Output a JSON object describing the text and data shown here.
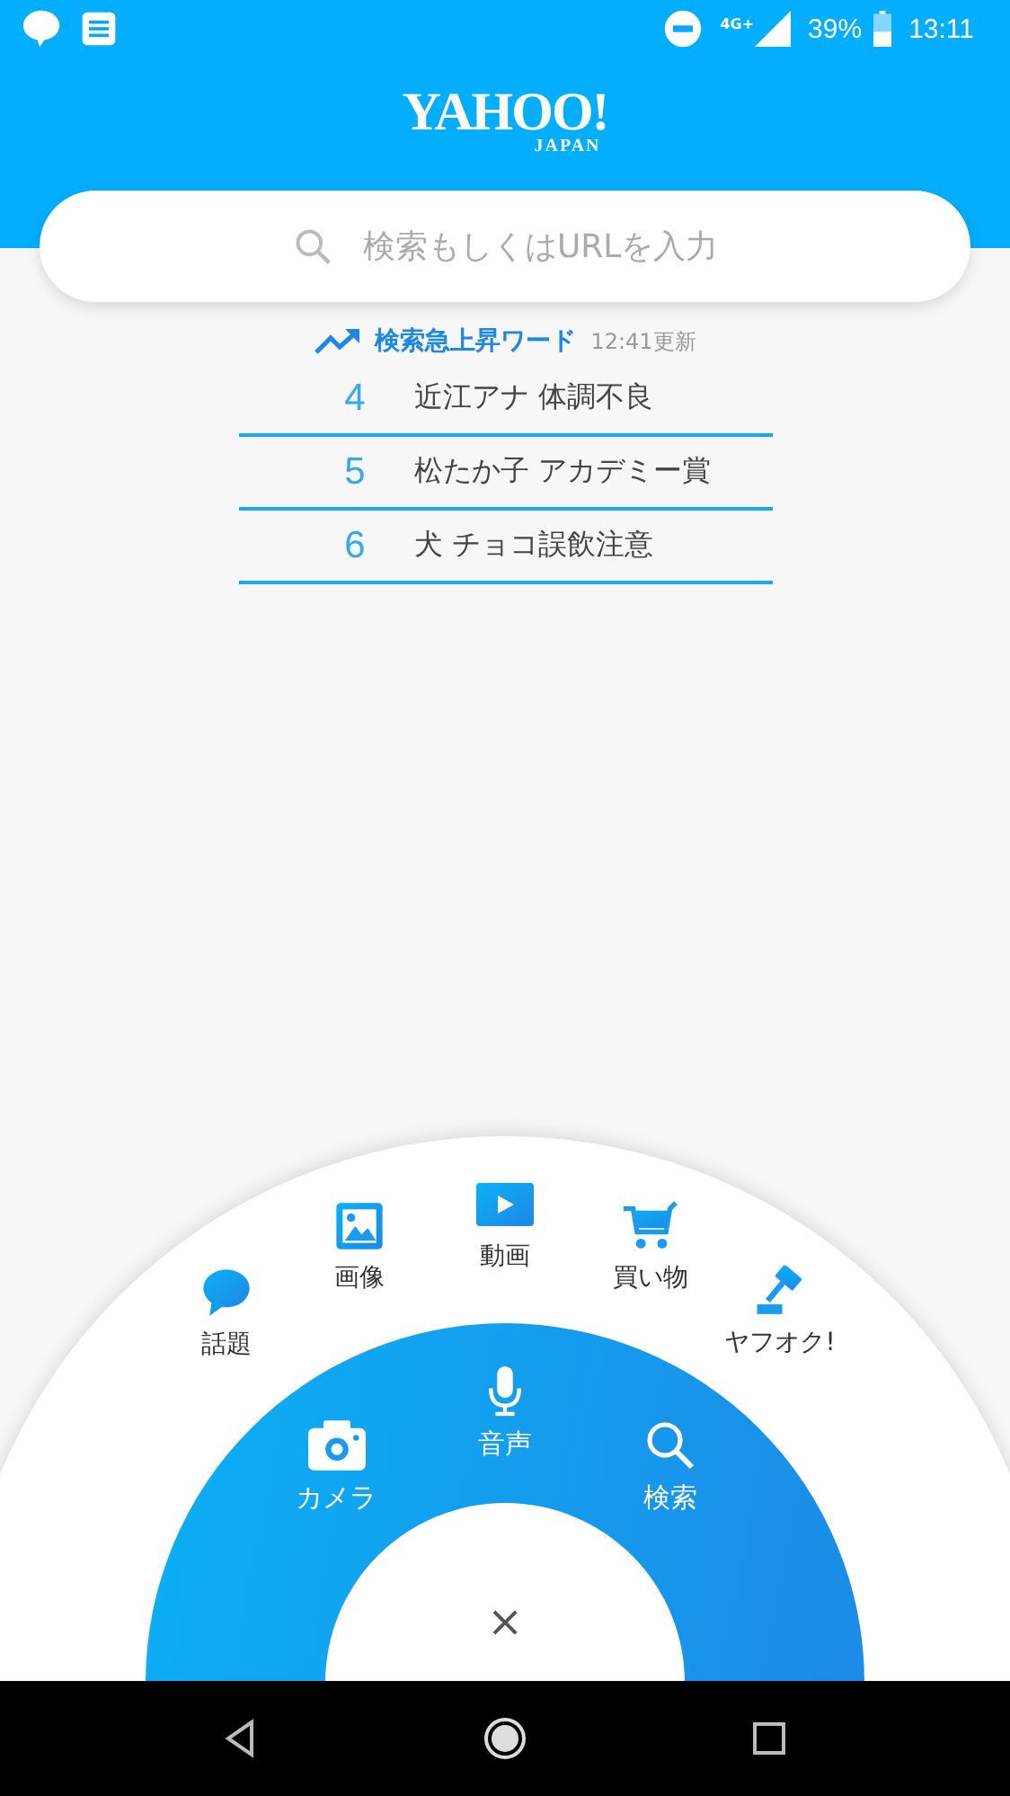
{
  "status_bar": {
    "network": "4G+",
    "battery": "39%",
    "time": "13:11"
  },
  "header": {
    "logo": "YAHOO!",
    "logo_sub": "JAPAN"
  },
  "search": {
    "placeholder": "検索もしくはURLを入力"
  },
  "trending": {
    "title": "検索急上昇ワード",
    "updated": "12:41更新",
    "items": [
      {
        "rank": "4",
        "text": "近江アナ 体調不良"
      },
      {
        "rank": "5",
        "text": "松たか子 アカデミー賞"
      },
      {
        "rank": "6",
        "text": "犬 チョコ誤飲注意"
      }
    ]
  },
  "menu": {
    "outer": [
      {
        "kind": "topic",
        "label": "話題"
      },
      {
        "kind": "image",
        "label": "画像"
      },
      {
        "kind": "video",
        "label": "動画"
      },
      {
        "kind": "shopping",
        "label": "買い物"
      },
      {
        "kind": "auction",
        "label": "ヤフオク!"
      }
    ],
    "inner": [
      {
        "kind": "camera",
        "label": "カメラ"
      },
      {
        "kind": "voice",
        "label": "音声"
      },
      {
        "kind": "search",
        "label": "検索"
      }
    ],
    "close": "×"
  }
}
